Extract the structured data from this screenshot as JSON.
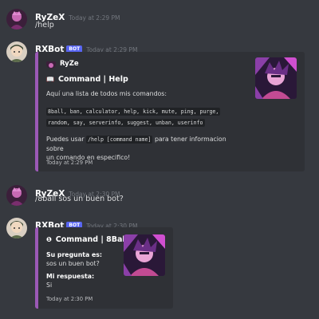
{
  "messages": [
    {
      "author": "RyZeX",
      "timestamp": "Today at 2:29 PM",
      "content": "/help"
    },
    {
      "author": "RXBot",
      "bot_tag": "BOT",
      "timestamp": "Today at 2:29 PM",
      "embed": {
        "author_name": "RyZe",
        "title_icon": "📖",
        "title": "Command | Help",
        "description": "Aquí una lista de todos mis comandos:",
        "commands_line1": "8ball, ban, calculator, help, kick, mute, ping, purge,",
        "commands_line2": "random, say, serverinfo, suggest, unban, userinfo",
        "usage_prefix": "Puedes usar",
        "usage_code": "/help [command name]",
        "usage_suffix": "para tener informacion sobre",
        "usage_line2": "un comando en especifico!",
        "footer": "Today at 2:29 PM"
      }
    },
    {
      "author": "RyZeX",
      "timestamp": "Today at 2:30 PM",
      "content": "/8ball sos un buen bot?"
    },
    {
      "author": "RXBot",
      "bot_tag": "BOT",
      "timestamp": "Today at 2:30 PM",
      "embed": {
        "title_icon": "❶",
        "title": "Command | 8Ball",
        "field1_name": "Su pregunta es:",
        "field1_value": "sos un buen bot?",
        "field2_name": "Mi respuesta:",
        "field2_value": "Si",
        "footer": "Today at 2:30 PM"
      }
    }
  ],
  "colors": {
    "background": "#36393f",
    "embed_bg": "#2f3136",
    "embed_accent": "#9b59b6",
    "bot_tag": "#5865f2"
  }
}
